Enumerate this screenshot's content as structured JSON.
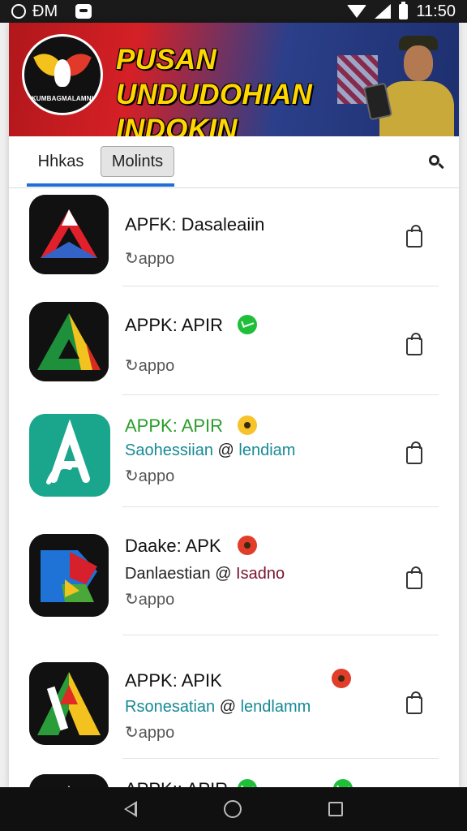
{
  "status_bar": {
    "left_text": "ĐM",
    "time": "11:50"
  },
  "banner": {
    "logo_text": "KUMBAGMALAMNI",
    "title": "PUSAN UNDUDOHIAN INDOKIN URSAIGIA!"
  },
  "tabs": [
    {
      "label": "Hhkas",
      "active": true
    },
    {
      "label": "Molints",
      "active": false
    }
  ],
  "apps": [
    {
      "title": "APFK: Dasaleaiin",
      "title_color": "dark",
      "badge": "",
      "subtitle_a": "",
      "subtitle_b": "",
      "type": "Cappo",
      "icon_colors": [
        "#111111",
        "#e0202a",
        "#ffffff",
        "#3463c7"
      ]
    },
    {
      "title": "APPK: APIR",
      "title_color": "dark",
      "badge": "messenger",
      "subtitle_a": "",
      "subtitle_b": "",
      "type": "Cappo",
      "icon_colors": [
        "#111111",
        "#1e8f3a",
        "#f2c21f",
        "#d52b20"
      ]
    },
    {
      "title": "APPK: APIR",
      "title_color": "green",
      "badge": "face-yellow",
      "subtitle_a": "Saohessiian",
      "subtitle_b": "lendiam",
      "type": "Cappo",
      "icon_colors": [
        "#1aa68c",
        "#ffffff",
        "#ffffff",
        "#1aa68c"
      ]
    },
    {
      "title": "Daake: APK",
      "title_color": "dark",
      "badge": "face-red",
      "subtitle_a": "Danlaestian",
      "subtitle_b": "Isadno",
      "type": "Cappo",
      "icon_colors": [
        "#111111",
        "#1f72d6",
        "#d6202c",
        "#4aa83a"
      ]
    },
    {
      "title": "APPK: APIK",
      "title_color": "dark",
      "badge": "face-red",
      "subtitle_a": "Rsonesatian",
      "subtitle_b": "lendlamm",
      "type": "Cappo",
      "icon_colors": [
        "#111111",
        "#e02a24",
        "#f3c21f",
        "#2a9d3a"
      ]
    },
    {
      "title": "APPK:: APIR",
      "title_color": "dark",
      "badge": "messenger",
      "subtitle_a": "",
      "subtitle_b": "",
      "type": "",
      "icon_colors": [
        "#111111",
        "#ffffff",
        "#1f6fd6",
        "#e0202a"
      ]
    }
  ]
}
